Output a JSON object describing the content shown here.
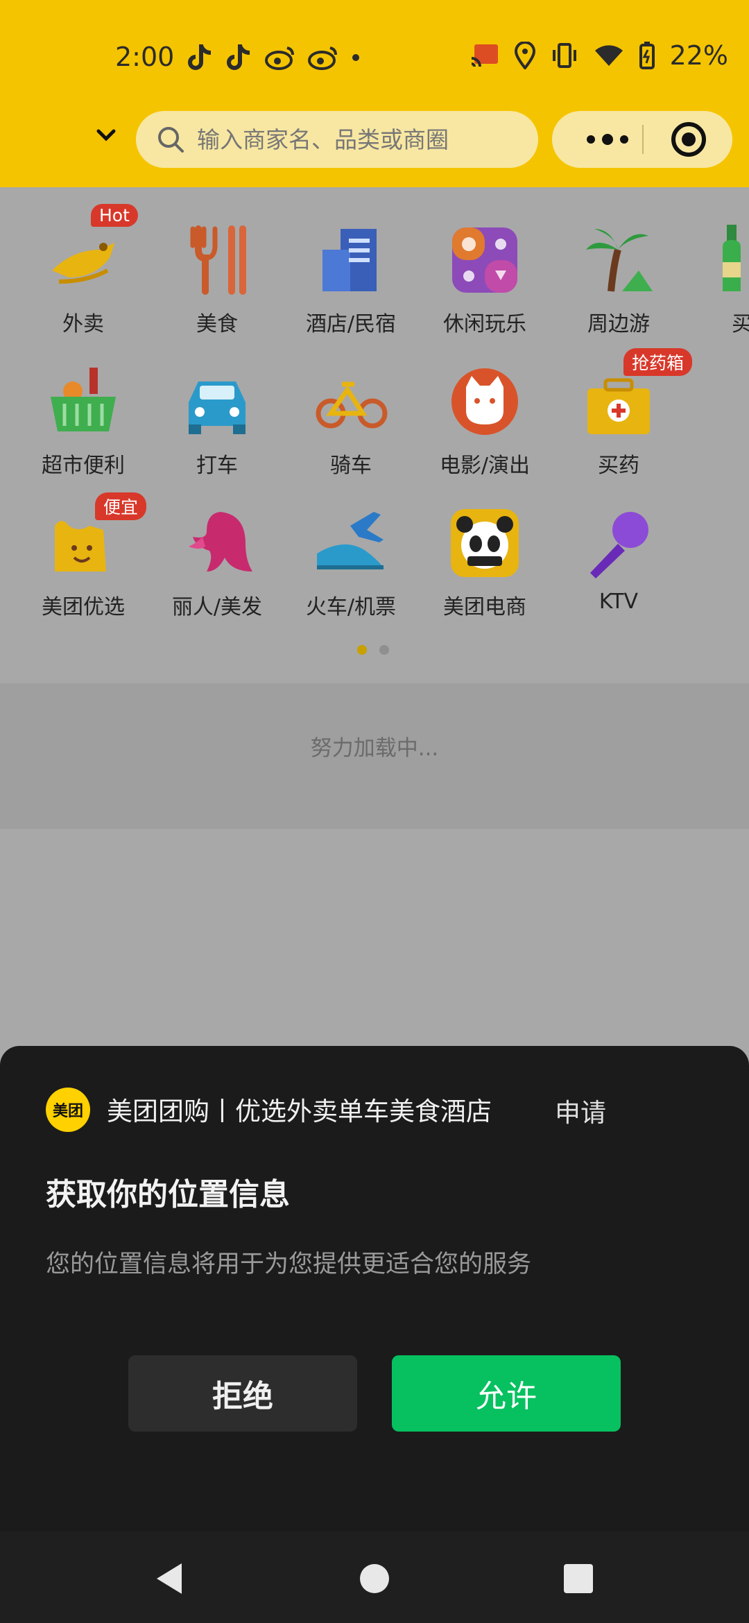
{
  "status_bar": {
    "time": "2:00",
    "battery": "22%"
  },
  "search": {
    "placeholder": "输入商家名、品类或商圈"
  },
  "categories": [
    {
      "label": "外卖",
      "badge": "Hot"
    },
    {
      "label": "美食"
    },
    {
      "label": "酒店/民宿"
    },
    {
      "label": "休闲玩乐"
    },
    {
      "label": "周边游"
    },
    {
      "label": "买酒"
    },
    {
      "label": "超市便利"
    },
    {
      "label": "打车"
    },
    {
      "label": "骑车"
    },
    {
      "label": "电影/演出"
    },
    {
      "label": "买药",
      "badge": "抢药箱"
    },
    {
      "label": "美团优选",
      "badge": "便宜"
    },
    {
      "label": "丽人/美发"
    },
    {
      "label": "火车/机票"
    },
    {
      "label": "美团电商"
    },
    {
      "label": "KTV"
    }
  ],
  "pager": {
    "page": 1,
    "total": 2
  },
  "loading_text": "努力加载中...",
  "permission_sheet": {
    "app_logo_text": "美团",
    "app_name": "美团团购丨优选外卖单车美食酒店",
    "apply_label": "申请",
    "title": "获取你的位置信息",
    "description": "您的位置信息将用于为您提供更适合您的服务",
    "deny_label": "拒绝",
    "allow_label": "允许"
  },
  "colors": {
    "brand_yellow": "#F5C400",
    "allow_green": "#07C160",
    "badge_red": "#D8382A"
  }
}
